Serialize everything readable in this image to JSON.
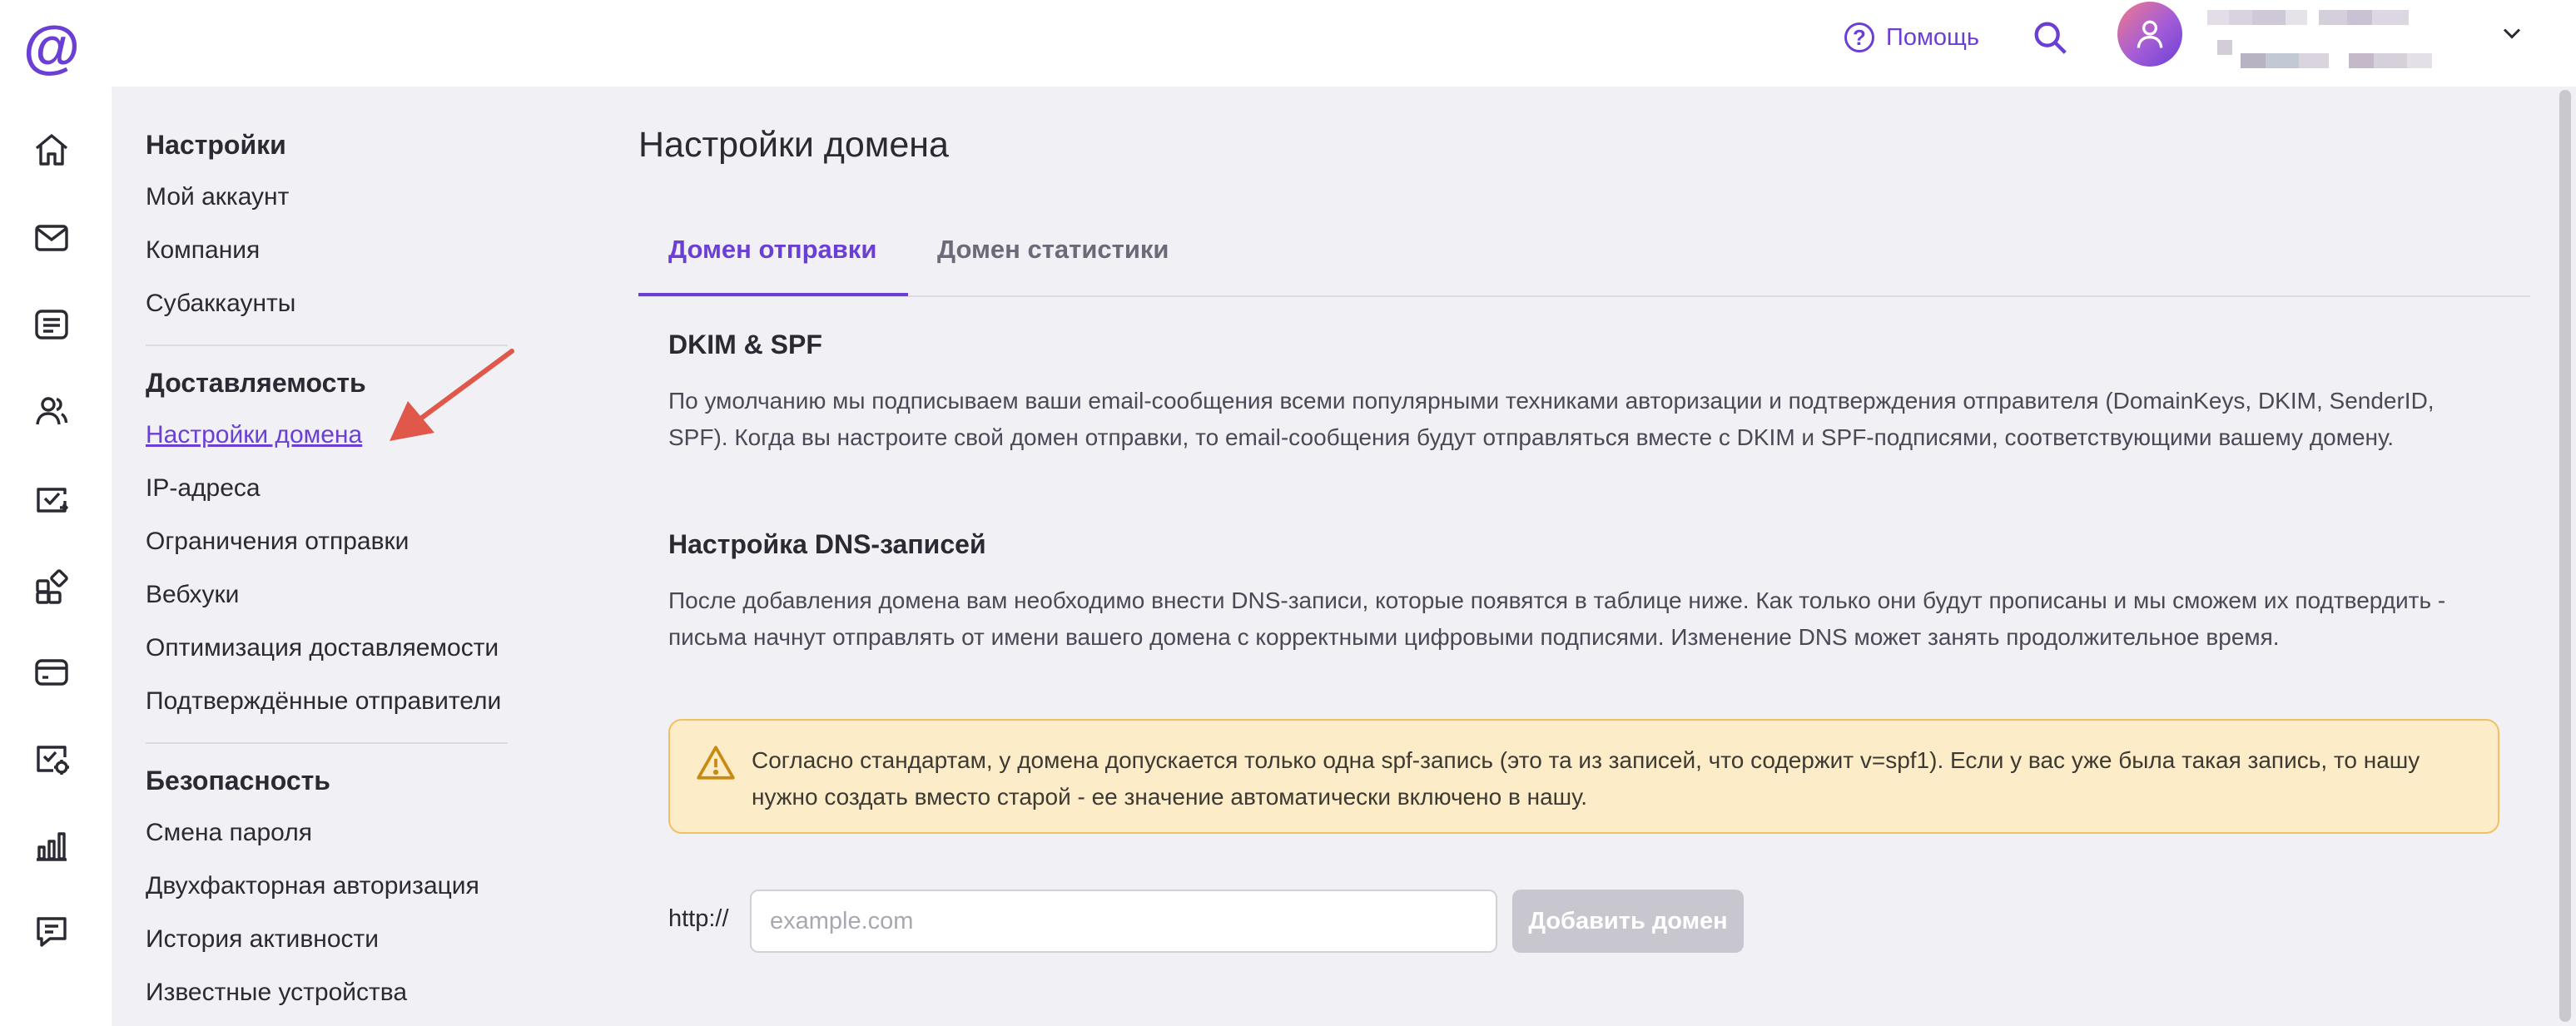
{
  "header": {
    "help_label": "Помощь",
    "help_icon": "question-circle-icon",
    "search_icon": "search-icon",
    "account_icon": "user-icon",
    "chevron_icon": "chevron-down-icon"
  },
  "rail": {
    "logo_text": "@",
    "icons": [
      "home-icon",
      "mail-icon",
      "templates-icon",
      "contacts-icon",
      "campaigns-icon",
      "integrations-icon",
      "billing-icon",
      "automation-icon",
      "stats-icon",
      "support-chat-icon"
    ]
  },
  "settings_nav": {
    "sections": [
      {
        "title": "Настройки",
        "items": [
          "Мой аккаунт",
          "Компания",
          "Субаккаунты"
        ]
      },
      {
        "title": "Доставляемость",
        "items": [
          "Настройки домена",
          "IP-адреса",
          "Ограничения отправки",
          "Вебхуки",
          "Оптимизация доставляемости",
          "Подтверждённые отправители"
        ]
      },
      {
        "title": "Безопасность",
        "items": [
          "Смена пароля",
          "Двухфакторная авторизация",
          "История активности",
          "Известные устройства"
        ]
      }
    ],
    "active_item": "Настройки домена"
  },
  "main": {
    "title": "Настройки домена",
    "tabs": [
      {
        "label": "Домен отправки",
        "active": true
      },
      {
        "label": "Домен статистики",
        "active": false
      }
    ],
    "dkim_heading": "DKIM & SPF",
    "dkim_text": "По умолчанию мы подписываем ваши email-сообщения всеми популярными техниками авторизации и подтверждения отправителя (DomainKeys, DKIM, SenderID, SPF). Когда вы настроите свой домен отправки, то email-сообщения будут отправляться вместе с DKIM и SPF-подписями, соответствующими вашему домену.",
    "dns_heading": "Настройка DNS-записей",
    "dns_text": "После добавления домена вам необходимо внести DNS-записи, которые появятся в таблице ниже. Как только они будут прописаны и мы сможем их подтвердить - письма начнут отправлять от имени вашего домена с корректными цифровыми подписями. Изменение DNS может занять продолжительное время.",
    "notice_text": "Согласно стандартам, у домена допускается только одна spf-запись (это та из записей, что содержит v=spf1). Если у вас уже была такая запись, то нашу нужно создать вместо старой - ее значение автоматически включено в нашу.",
    "notice_icon": "warning-icon",
    "domain_prefix": "http://",
    "domain_input": {
      "value": "",
      "placeholder": "example.com"
    },
    "add_button_label": "Добавить домен"
  },
  "colors": {
    "accent": "#6b3fd4",
    "content_bg": "#f1f0f5",
    "notice_bg": "#fcecc8",
    "notice_border": "#f1c063",
    "disabled_button": "#c8c7cf",
    "annotation_arrow": "#e0584a"
  }
}
